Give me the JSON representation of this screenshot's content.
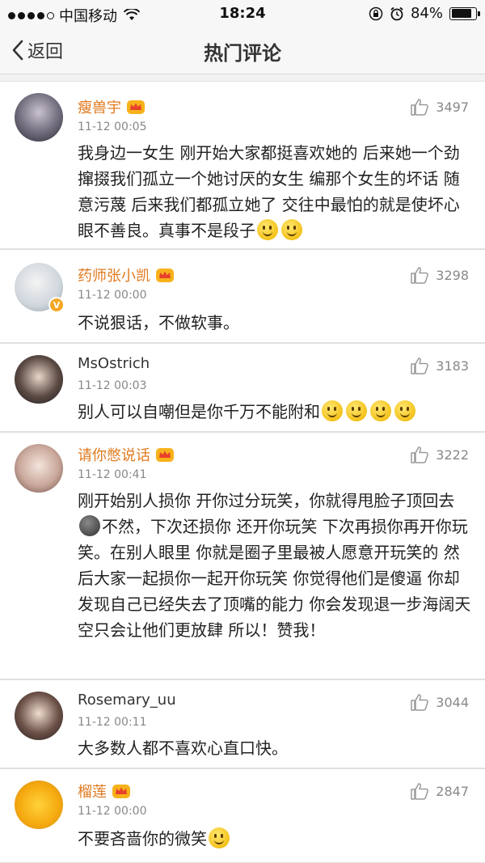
{
  "status_bar": {
    "carrier": "中国移动",
    "time": "18:24",
    "battery": "84%",
    "battery_level": 0.84
  },
  "nav": {
    "back_label": "返回",
    "title": "热门评论"
  },
  "comments": [
    {
      "username": "瘦兽宇",
      "time": "11-12 00:05",
      "likes": "3497",
      "text": "我身边一女生 刚开始大家都挺喜欢她的 后来她一个劲撺掇我们孤立一个她讨厌的女生 编那个女生的坏话 随意污蔑 后来我们都孤立她了 交往中最怕的就是使坏心眼不善良。真事不是段子",
      "emoji_after": [
        "smile-emoji",
        "smile-emoji"
      ]
    },
    {
      "username": "药师张小凯",
      "time": "11-12 00:00",
      "likes": "3298",
      "text": "不说狠话，不做软事。",
      "verified": "V"
    },
    {
      "username": "MsOstrich",
      "time": "11-12 00:03",
      "likes": "3183",
      "text": "别人可以自嘲但是你千万不能附和",
      "emoji_after": [
        "smile-emoji",
        "smile-emoji",
        "smile-emoji",
        "smile-emoji"
      ]
    },
    {
      "username": "请你憋说话",
      "time": "11-12 00:41",
      "likes": "3222",
      "text_part1": "刚开始别人损你 开你过分玩笑，你就得甩脸子顶回去",
      "text_part2": "不然，下次还损你 还开你玩笑 下次再损你再开你玩笑。在别人眼里 你就是圈子里最被人愿意开玩笑的 然后大家一起损你一起开你玩笑 你觉得他们是傻逼 你却发现自己已经失去了顶嘴的能力 你会发现退一步海阔天空只会让他们更放肆 所以！赞我！"
    },
    {
      "username": "Rosemary_uu",
      "time": "11-12 00:11",
      "likes": "3044",
      "text": "大多数人都不喜欢心直口快。"
    },
    {
      "username": "榴莲",
      "time": "11-12 00:00",
      "likes": "2847",
      "text": "不要吝啬你的微笑"
    }
  ],
  "colors": {
    "username_vip": "#e07a1f",
    "username_plain": "#333333",
    "meta": "#888888",
    "background": "#f2f2f2"
  },
  "icons": [
    "signal-dots-icon",
    "wifi-icon",
    "lock-rotation-icon",
    "alarm-icon",
    "battery-icon",
    "back-chevron-icon",
    "vip-crown-icon",
    "thumbs-up-icon",
    "smile-emoji",
    "dark-moon-emoji",
    "verified-badge-icon"
  ]
}
